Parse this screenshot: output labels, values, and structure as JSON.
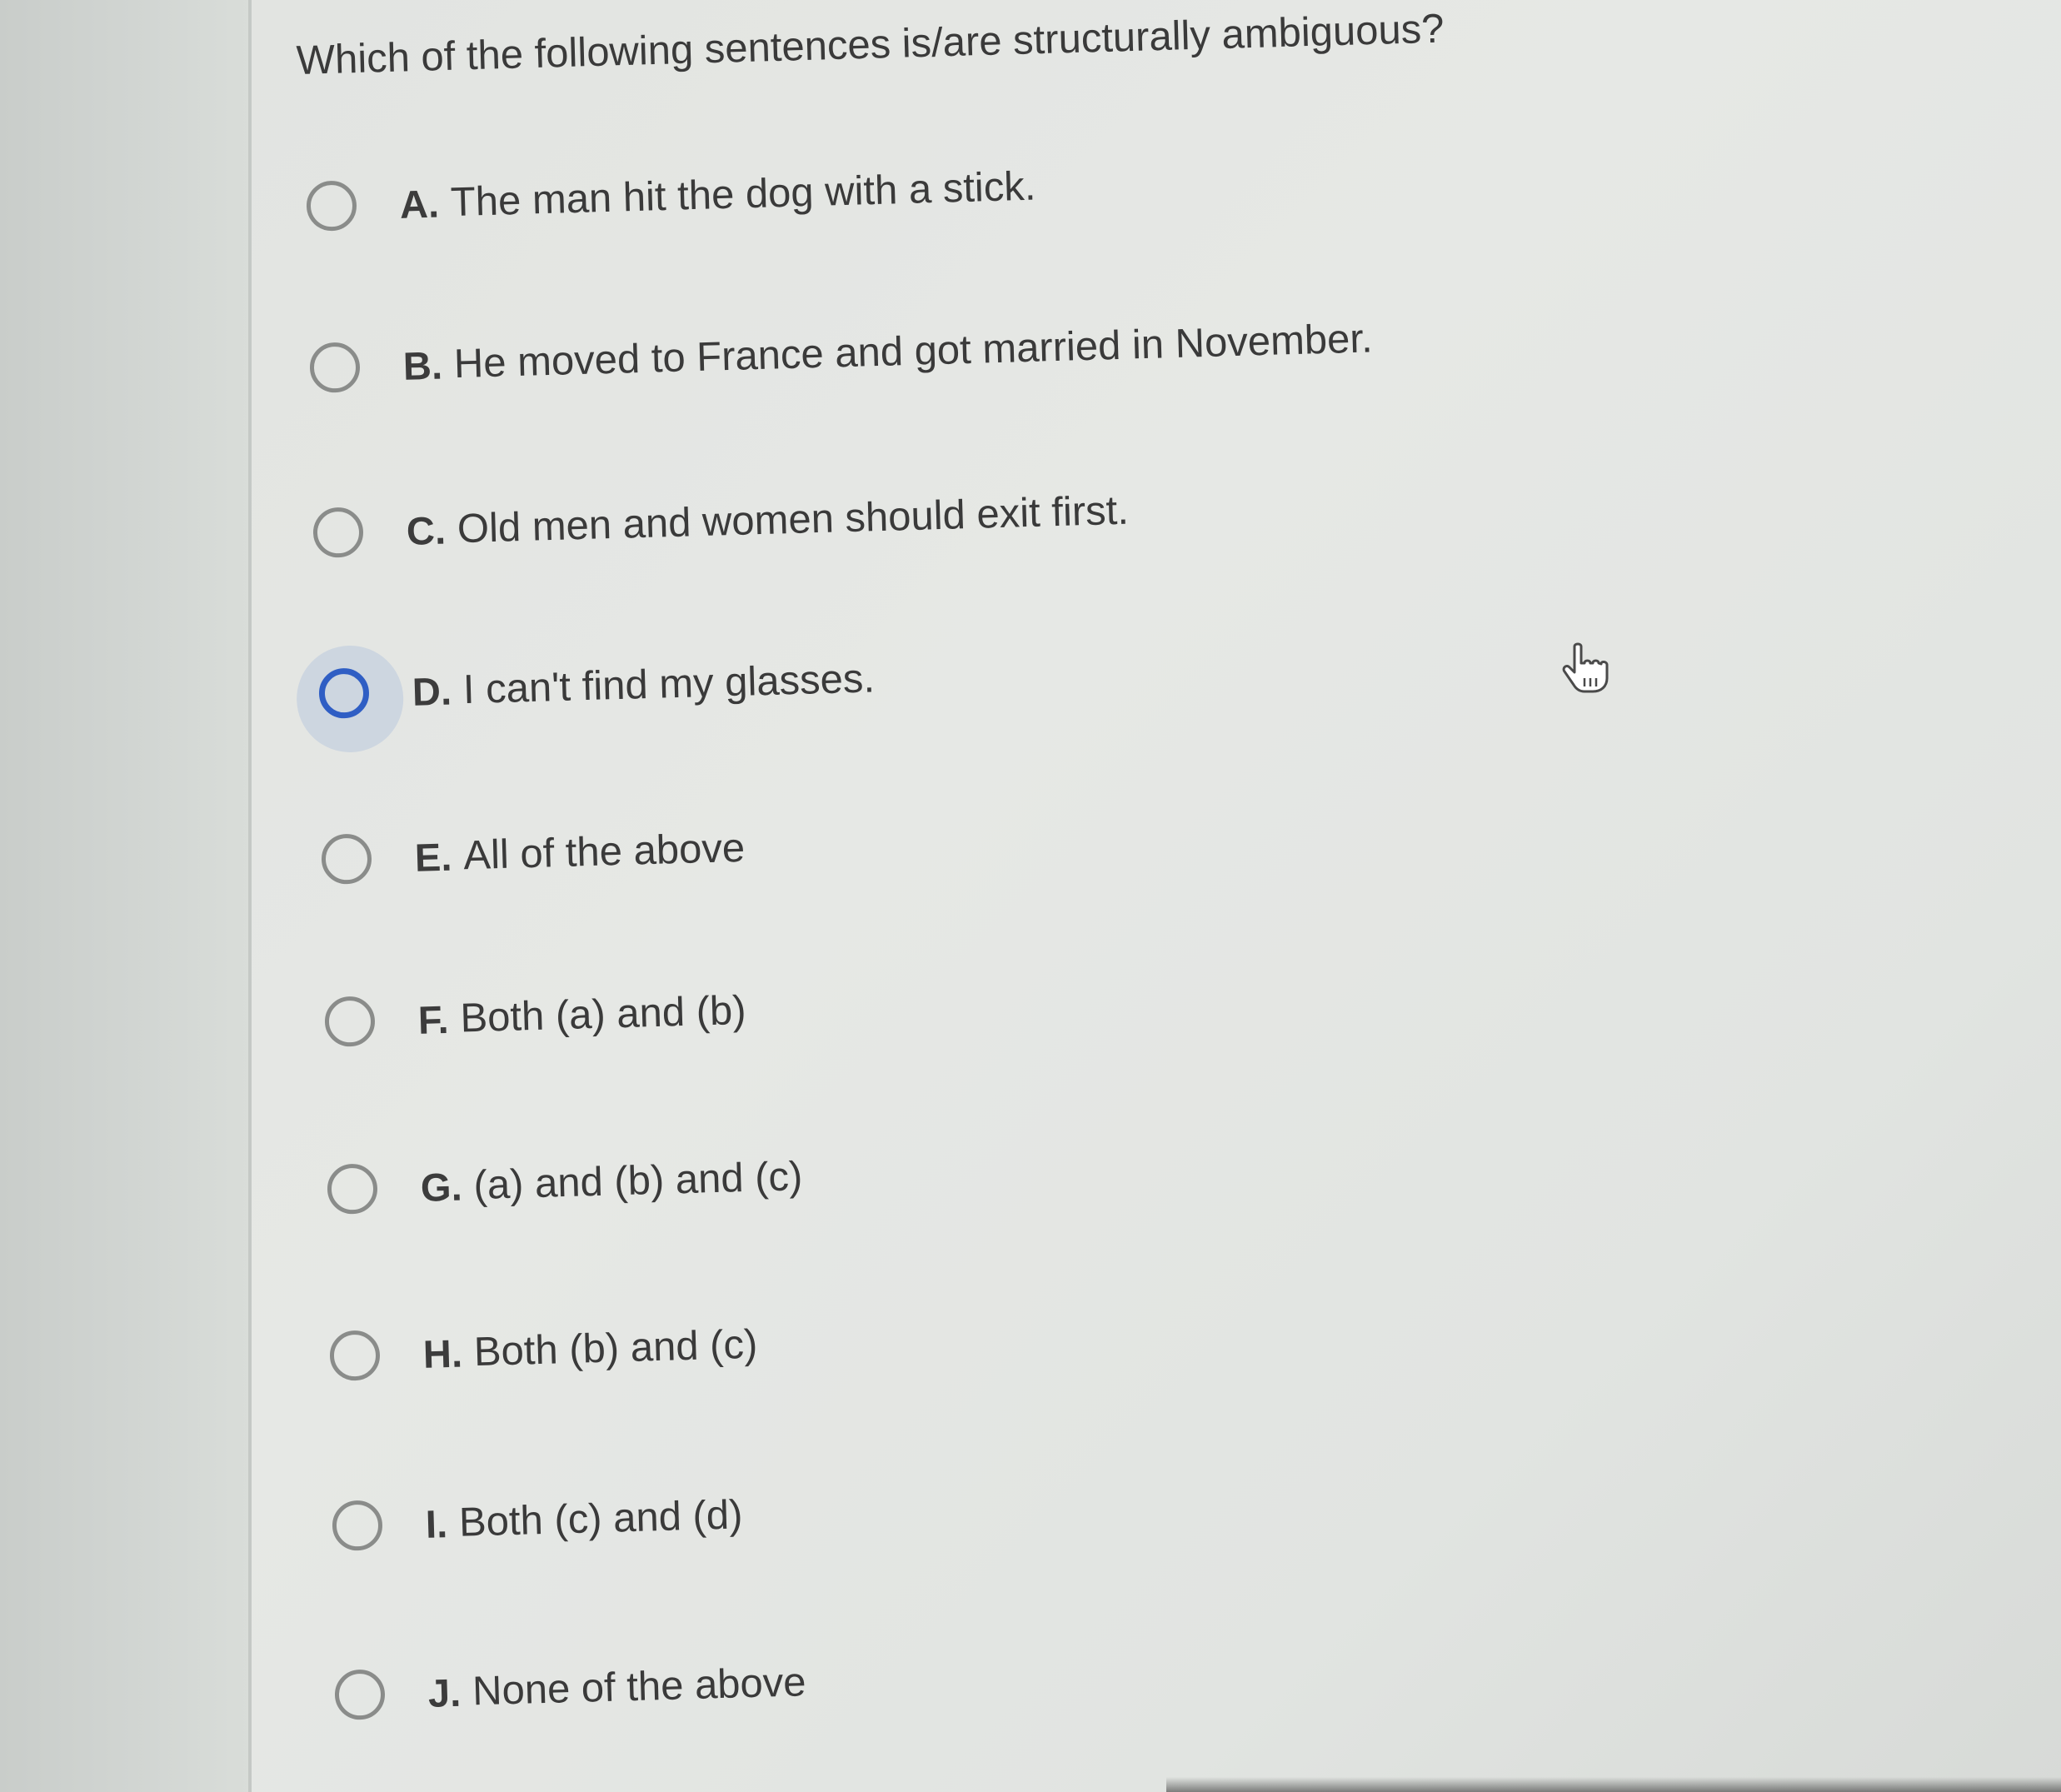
{
  "question": {
    "text": "Which of the following sentences is/are structurally ambiguous?"
  },
  "options": [
    {
      "letter": "A.",
      "text": "The man hit the dog with a stick.",
      "selected": false
    },
    {
      "letter": "B.",
      "text": "He moved to France and got married in November.",
      "selected": false
    },
    {
      "letter": "C.",
      "text": "Old men and women should exit first.",
      "selected": false
    },
    {
      "letter": "D.",
      "text": "I can't find my glasses.",
      "selected": false,
      "focused": true
    },
    {
      "letter": "E.",
      "text": "All of the above",
      "selected": false
    },
    {
      "letter": "F.",
      "text": "Both (a) and (b)",
      "selected": false
    },
    {
      "letter": "G.",
      "text": "(a) and (b) and (c)",
      "selected": false
    },
    {
      "letter": "H.",
      "text": "Both (b) and (c)",
      "selected": false
    },
    {
      "letter": "I.",
      "text": "Both (c) and (d)",
      "selected": false
    },
    {
      "letter": "J.",
      "text": "None of the above",
      "selected": false
    }
  ],
  "colors": {
    "focus_ring": "#2f5ec4",
    "radio_border": "#8a8c8a",
    "text": "#3a3a3a"
  },
  "cursor": {
    "icon": "hand-pointer-icon"
  }
}
